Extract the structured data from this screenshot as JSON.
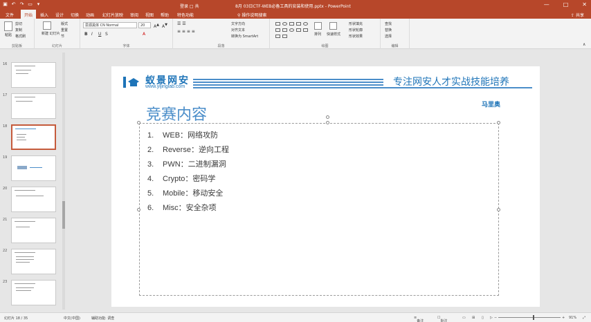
{
  "titlebar": {
    "login_text": "登录 □ 共",
    "doc_title": "8月 03日CTF-WEB必备工具的安装和使用.pptx - PowerPoint",
    "window_buttons": [
      "—",
      "□",
      "✕"
    ]
  },
  "tabs": [
    {
      "label": "文件"
    },
    {
      "label": "开始"
    },
    {
      "label": "插入"
    },
    {
      "label": "设计"
    },
    {
      "label": "切换"
    },
    {
      "label": "动画"
    },
    {
      "label": "幻灯片放映"
    },
    {
      "label": "审阅"
    },
    {
      "label": "视图"
    },
    {
      "label": "帮助"
    },
    {
      "label": "特色功能"
    }
  ],
  "tellme": "操作说明搜索",
  "share": "共享",
  "ribbon": {
    "clipboard": {
      "name": "剪贴板",
      "paste": "粘贴",
      "cut": "剪切",
      "copy": "复制",
      "format": "格式刷"
    },
    "slides": {
      "name": "幻灯片",
      "new_slide": "新建\n幻灯片",
      "layout": "版式",
      "reset": "重置",
      "section": "节"
    },
    "font": {
      "name": "字体",
      "font_name": "思源黑体 CN Normal",
      "font_size": "20"
    },
    "paragraph": {
      "name": "段落",
      "text_direction": "文字方向",
      "align_text": "对齐文本",
      "smartart": "转换为 SmartArt"
    },
    "drawing": {
      "name": "绘图",
      "arrange": "排列",
      "quick_styles": "快速样式",
      "fill": "形状填充",
      "outline": "形状轮廓",
      "effects": "形状效果"
    },
    "editing": {
      "name": "编辑",
      "find": "查找",
      "replace": "替换",
      "select": "选择"
    }
  },
  "thumbnails": [
    {
      "num": "16"
    },
    {
      "num": "17"
    },
    {
      "num": "18"
    },
    {
      "num": "19"
    },
    {
      "num": "20"
    },
    {
      "num": "21"
    },
    {
      "num": "22"
    },
    {
      "num": "23"
    }
  ],
  "slide": {
    "logo_cn": "蚁景网安",
    "logo_url": "www.yijinglab.com",
    "tagline": "专注网安人才实战技能培养",
    "author": "马里奥",
    "title": "竞赛内容",
    "items": [
      {
        "num": "1.",
        "text": "WEB：网络攻防"
      },
      {
        "num": "2.",
        "text": "Reverse：逆向工程"
      },
      {
        "num": "3.",
        "text": "PWN：二进制漏洞"
      },
      {
        "num": "4.",
        "text": "Crypto：密码学"
      },
      {
        "num": "5.",
        "text": "Mobile：移动安全"
      },
      {
        "num": "6.",
        "text": "Misc：安全杂项"
      }
    ],
    "colors": {
      "brand_blue": "#1e74b8",
      "title_blue": "#4a8dc9",
      "ribbon_red": "#b7472a"
    }
  },
  "statusbar": {
    "slide_info": "幻灯片 18 / 35",
    "language": "中文(中国)",
    "accessibility": "辅助功能: 调查",
    "notes": "备注",
    "comments": "批注",
    "zoom": "91%"
  }
}
